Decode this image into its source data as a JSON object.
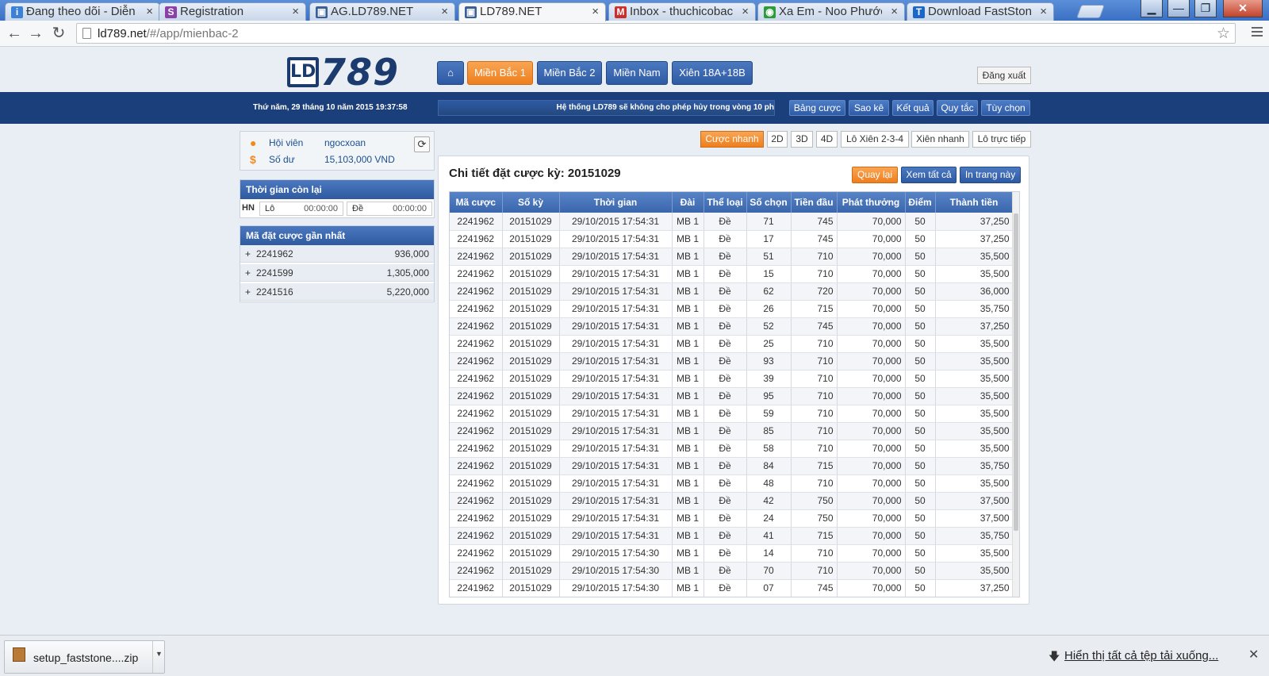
{
  "browser": {
    "tabs": [
      {
        "label": "Đang theo dõi - Diễn",
        "icon": "tracking-icon",
        "color": "#3b82d6",
        "glyph": "i"
      },
      {
        "label": "Registration",
        "icon": "s-logo-icon",
        "color": "#8b3fa8",
        "glyph": "S"
      },
      {
        "label": "AG.LD789.NET",
        "icon": "page-icon",
        "color": "#3a5f95",
        "glyph": "▣"
      },
      {
        "label": "LD789.NET",
        "icon": "page-icon",
        "color": "#3a5f95",
        "glyph": "▣"
      },
      {
        "label": "Inbox - thuchicobac",
        "icon": "gmail-icon",
        "color": "#c9302c",
        "glyph": "M"
      },
      {
        "label": "Xa Em - Noo Phước",
        "icon": "chrome-icon",
        "color": "#2a9d3a",
        "glyph": "◉"
      },
      {
        "label": "Download FastStone",
        "icon": "t-logo-icon",
        "color": "#1b66c9",
        "glyph": "T"
      }
    ],
    "url_host": "ld789.net",
    "url_path": "/#/app/mienbac-2"
  },
  "header": {
    "logo_letters": "LD",
    "logo_number": "789",
    "nav": [
      "Miền Bắc 1",
      "Miền Bắc 2",
      "Miền Nam",
      "Xiên 18A+18B"
    ],
    "logout": "Đăng xuất",
    "datetime": "Thứ năm, 29 tháng 10 năm 2015 19:37:58",
    "marquee": "Hệ thống LD789 sẽ không cho phép hủy trong vòng 10 ph",
    "subnav": [
      "Bảng cược",
      "Sao kê",
      "Kết quả",
      "Quy tắc",
      "Tùy chọn"
    ]
  },
  "user": {
    "member_label": "Hội viên",
    "member_value": "ngocxoan",
    "balance_label": "Số dư",
    "balance_value": "15,103,000 VND"
  },
  "time_left": {
    "title": "Thời gian còn lại",
    "region": "HN",
    "lo_label": "Lô",
    "lo_value": "00:00:00",
    "de_label": "Đề",
    "de_value": "00:00:00"
  },
  "recent": {
    "title": "Mã đặt cược gần nhất",
    "items": [
      {
        "code": "2241962",
        "amount": "936,000"
      },
      {
        "code": "2241599",
        "amount": "1,305,000"
      },
      {
        "code": "2241516",
        "amount": "5,220,000"
      }
    ]
  },
  "bet_tabs": [
    "Cược nhanh",
    "2D",
    "3D",
    "4D",
    "Lô Xiên 2-3-4",
    "Xiên nhanh",
    "Lô trực tiếp"
  ],
  "detail": {
    "title": "Chi tiết đặt cược kỳ: 20151029",
    "buttons": [
      "Quay lại",
      "Xem tất cả",
      "In trang này"
    ],
    "columns": [
      "Mã cược",
      "Số kỳ",
      "Thời gian",
      "Đài",
      "Thể loại",
      "Số chọn",
      "Tiền đầu",
      "Phát thưởng",
      "Điểm",
      "Thành tiền"
    ],
    "rows": [
      [
        "2241962",
        "20151029",
        "29/10/2015 17:54:31",
        "MB 1",
        "Đề",
        "71",
        "745",
        "70,000",
        "50",
        "37,250"
      ],
      [
        "2241962",
        "20151029",
        "29/10/2015 17:54:31",
        "MB 1",
        "Đề",
        "17",
        "745",
        "70,000",
        "50",
        "37,250"
      ],
      [
        "2241962",
        "20151029",
        "29/10/2015 17:54:31",
        "MB 1",
        "Đề",
        "51",
        "710",
        "70,000",
        "50",
        "35,500"
      ],
      [
        "2241962",
        "20151029",
        "29/10/2015 17:54:31",
        "MB 1",
        "Đề",
        "15",
        "710",
        "70,000",
        "50",
        "35,500"
      ],
      [
        "2241962",
        "20151029",
        "29/10/2015 17:54:31",
        "MB 1",
        "Đề",
        "62",
        "720",
        "70,000",
        "50",
        "36,000"
      ],
      [
        "2241962",
        "20151029",
        "29/10/2015 17:54:31",
        "MB 1",
        "Đề",
        "26",
        "715",
        "70,000",
        "50",
        "35,750"
      ],
      [
        "2241962",
        "20151029",
        "29/10/2015 17:54:31",
        "MB 1",
        "Đề",
        "52",
        "745",
        "70,000",
        "50",
        "37,250"
      ],
      [
        "2241962",
        "20151029",
        "29/10/2015 17:54:31",
        "MB 1",
        "Đề",
        "25",
        "710",
        "70,000",
        "50",
        "35,500"
      ],
      [
        "2241962",
        "20151029",
        "29/10/2015 17:54:31",
        "MB 1",
        "Đề",
        "93",
        "710",
        "70,000",
        "50",
        "35,500"
      ],
      [
        "2241962",
        "20151029",
        "29/10/2015 17:54:31",
        "MB 1",
        "Đề",
        "39",
        "710",
        "70,000",
        "50",
        "35,500"
      ],
      [
        "2241962",
        "20151029",
        "29/10/2015 17:54:31",
        "MB 1",
        "Đề",
        "95",
        "710",
        "70,000",
        "50",
        "35,500"
      ],
      [
        "2241962",
        "20151029",
        "29/10/2015 17:54:31",
        "MB 1",
        "Đề",
        "59",
        "710",
        "70,000",
        "50",
        "35,500"
      ],
      [
        "2241962",
        "20151029",
        "29/10/2015 17:54:31",
        "MB 1",
        "Đề",
        "85",
        "710",
        "70,000",
        "50",
        "35,500"
      ],
      [
        "2241962",
        "20151029",
        "29/10/2015 17:54:31",
        "MB 1",
        "Đề",
        "58",
        "710",
        "70,000",
        "50",
        "35,500"
      ],
      [
        "2241962",
        "20151029",
        "29/10/2015 17:54:31",
        "MB 1",
        "Đề",
        "84",
        "715",
        "70,000",
        "50",
        "35,750"
      ],
      [
        "2241962",
        "20151029",
        "29/10/2015 17:54:31",
        "MB 1",
        "Đề",
        "48",
        "710",
        "70,000",
        "50",
        "35,500"
      ],
      [
        "2241962",
        "20151029",
        "29/10/2015 17:54:31",
        "MB 1",
        "Đề",
        "42",
        "750",
        "70,000",
        "50",
        "37,500"
      ],
      [
        "2241962",
        "20151029",
        "29/10/2015 17:54:31",
        "MB 1",
        "Đề",
        "24",
        "750",
        "70,000",
        "50",
        "37,500"
      ],
      [
        "2241962",
        "20151029",
        "29/10/2015 17:54:31",
        "MB 1",
        "Đề",
        "41",
        "715",
        "70,000",
        "50",
        "35,750"
      ],
      [
        "2241962",
        "20151029",
        "29/10/2015 17:54:30",
        "MB 1",
        "Đề",
        "14",
        "710",
        "70,000",
        "50",
        "35,500"
      ],
      [
        "2241962",
        "20151029",
        "29/10/2015 17:54:30",
        "MB 1",
        "Đề",
        "70",
        "710",
        "70,000",
        "50",
        "35,500"
      ],
      [
        "2241962",
        "20151029",
        "29/10/2015 17:54:30",
        "MB 1",
        "Đề",
        "07",
        "745",
        "70,000",
        "50",
        "37,250"
      ]
    ]
  },
  "downloads": {
    "file": "setup_faststone....zip",
    "show_all": "Hiển thị tất cả tệp tải xuống..."
  }
}
